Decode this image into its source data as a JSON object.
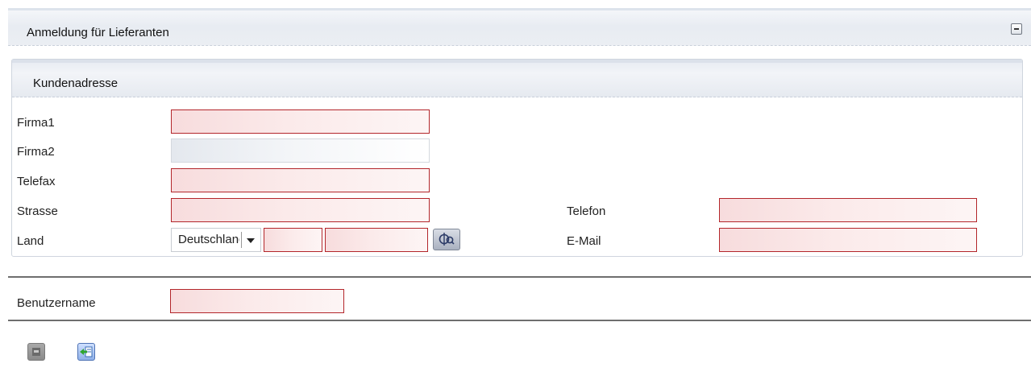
{
  "panel": {
    "title": "Anmeldung für Lieferanten",
    "collapse_icon": "minus-collapse-icon"
  },
  "address": {
    "title": "Kundenadresse",
    "labels": {
      "firma1": "Firma1",
      "firma2": "Firma2",
      "telefax": "Telefax",
      "strasse": "Strasse",
      "land": "Land",
      "telefon": "Telefon",
      "email": "E-Mail"
    },
    "values": {
      "firma1": "",
      "firma2": "",
      "telefax": "",
      "strasse": "",
      "plz": "",
      "ort": "",
      "telefon": "",
      "email": ""
    },
    "land_selected": "Deutschland",
    "search_icon": "address-lookup-icon"
  },
  "user": {
    "label": "Benutzername",
    "value": ""
  },
  "footer": {
    "save_icon": "save-disk-icon",
    "login_icon": "login-arrow-icon"
  },
  "colors": {
    "required_border": "#b3262b",
    "header_bg": "#e8ecf2",
    "accent_green": "#2fa52f"
  }
}
